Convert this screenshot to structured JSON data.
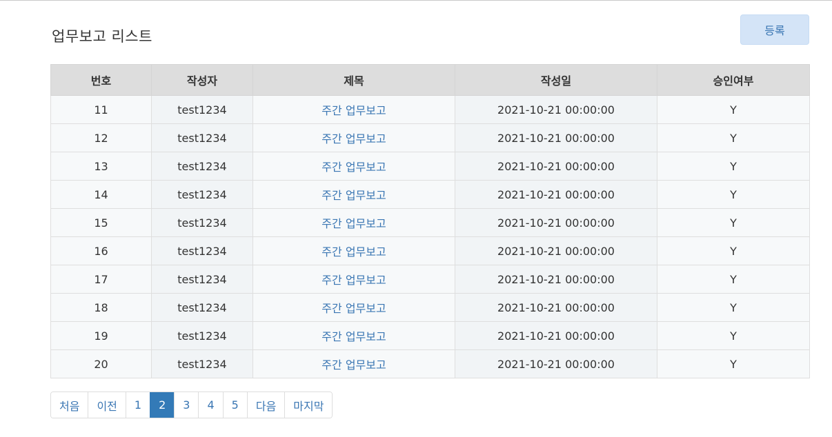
{
  "page": {
    "title": "업무보고 리스트",
    "register_label": "등록"
  },
  "table": {
    "headers": [
      "번호",
      "작성자",
      "제목",
      "작성일",
      "승인여부"
    ],
    "rows": [
      {
        "no": "11",
        "writer": "test1234",
        "title": "주간 업무보고",
        "date": "2021-10-21 00:00:00",
        "approved": "Y"
      },
      {
        "no": "12",
        "writer": "test1234",
        "title": "주간 업무보고",
        "date": "2021-10-21 00:00:00",
        "approved": "Y"
      },
      {
        "no": "13",
        "writer": "test1234",
        "title": "주간 업무보고",
        "date": "2021-10-21 00:00:00",
        "approved": "Y"
      },
      {
        "no": "14",
        "writer": "test1234",
        "title": "주간 업무보고",
        "date": "2021-10-21 00:00:00",
        "approved": "Y"
      },
      {
        "no": "15",
        "writer": "test1234",
        "title": "주간 업무보고",
        "date": "2021-10-21 00:00:00",
        "approved": "Y"
      },
      {
        "no": "16",
        "writer": "test1234",
        "title": "주간 업무보고",
        "date": "2021-10-21 00:00:00",
        "approved": "Y"
      },
      {
        "no": "17",
        "writer": "test1234",
        "title": "주간 업무보고",
        "date": "2021-10-21 00:00:00",
        "approved": "Y"
      },
      {
        "no": "18",
        "writer": "test1234",
        "title": "주간 업무보고",
        "date": "2021-10-21 00:00:00",
        "approved": "Y"
      },
      {
        "no": "19",
        "writer": "test1234",
        "title": "주간 업무보고",
        "date": "2021-10-21 00:00:00",
        "approved": "Y"
      },
      {
        "no": "20",
        "writer": "test1234",
        "title": "주간 업무보고",
        "date": "2021-10-21 00:00:00",
        "approved": "Y"
      }
    ]
  },
  "pagination": {
    "first": "처음",
    "prev": "이전",
    "pages": [
      "1",
      "2",
      "3",
      "4",
      "5"
    ],
    "current": "2",
    "next": "다음",
    "last": "마지막"
  },
  "colors": {
    "accent": "#337ab7",
    "link": "#3a76b3",
    "header_bg": "#dddddd",
    "button_bg": "#d4e4f7"
  }
}
